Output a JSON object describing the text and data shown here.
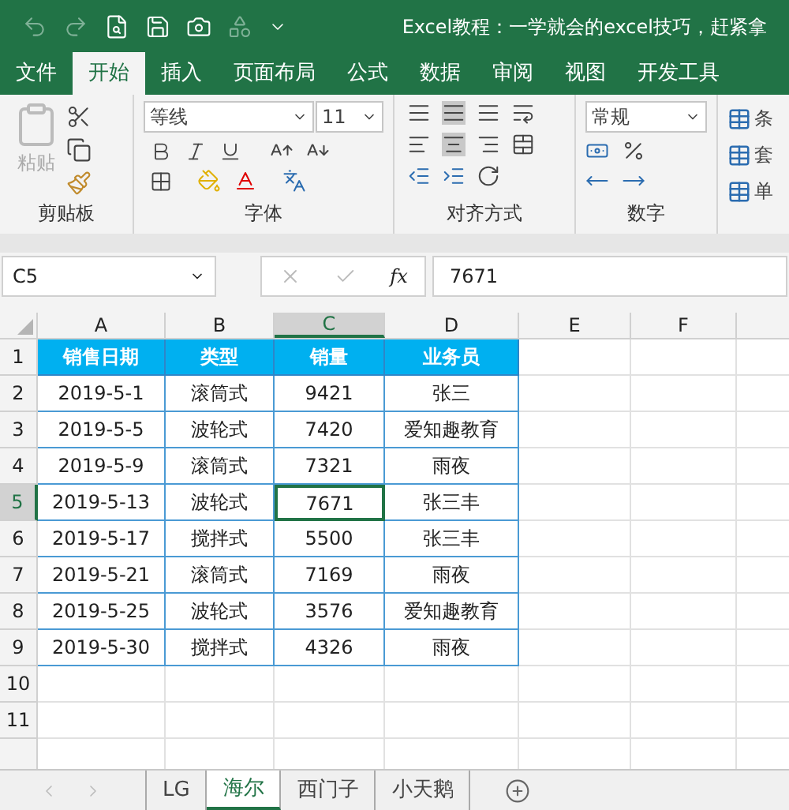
{
  "title_bar": {
    "title": "Excel教程：一学就会的excel技巧，赶紧拿"
  },
  "ribbon_tabs": [
    {
      "label": "文件",
      "selected": false
    },
    {
      "label": "开始",
      "selected": true
    },
    {
      "label": "插入",
      "selected": false
    },
    {
      "label": "页面布局",
      "selected": false
    },
    {
      "label": "公式",
      "selected": false
    },
    {
      "label": "数据",
      "selected": false
    },
    {
      "label": "审阅",
      "selected": false
    },
    {
      "label": "视图",
      "selected": false
    },
    {
      "label": "开发工具",
      "selected": false
    }
  ],
  "ribbon": {
    "clipboard": {
      "paste_label": "粘贴",
      "paste_disabled": true,
      "group_label": "剪贴板"
    },
    "font": {
      "font_name": "等线",
      "font_size": "11",
      "group_label": "字体"
    },
    "alignment": {
      "group_label": "对齐方式"
    },
    "number": {
      "format": "常规",
      "group_label": "数字"
    },
    "styles": {
      "items": [
        "条",
        "套",
        "单"
      ]
    }
  },
  "formula_bar": {
    "name_box": "C5",
    "function_button": "fx",
    "formula": "7671"
  },
  "columns": [
    {
      "label": "A",
      "selected": false
    },
    {
      "label": "B",
      "selected": false
    },
    {
      "label": "C",
      "selected": true
    },
    {
      "label": "D",
      "selected": false
    },
    {
      "label": "E",
      "selected": false
    },
    {
      "label": "F",
      "selected": false
    }
  ],
  "rows": [
    {
      "number": "1",
      "selected": false,
      "kind": "header",
      "cells": [
        {
          "text": "销售日期",
          "selected": false
        },
        {
          "text": "类型",
          "selected": false
        },
        {
          "text": "销量",
          "selected": false
        },
        {
          "text": "业务员",
          "selected": false
        }
      ]
    },
    {
      "number": "2",
      "selected": false,
      "kind": "data",
      "cells": [
        {
          "text": "2019-5-1",
          "selected": false
        },
        {
          "text": "滚筒式",
          "selected": false
        },
        {
          "text": "9421",
          "selected": false
        },
        {
          "text": "张三",
          "selected": false
        }
      ]
    },
    {
      "number": "3",
      "selected": false,
      "kind": "data",
      "cells": [
        {
          "text": "2019-5-5",
          "selected": false
        },
        {
          "text": "波轮式",
          "selected": false
        },
        {
          "text": "7420",
          "selected": false
        },
        {
          "text": "爱知趣教育",
          "selected": false
        }
      ]
    },
    {
      "number": "4",
      "selected": false,
      "kind": "data",
      "cells": [
        {
          "text": "2019-5-9",
          "selected": false
        },
        {
          "text": "滚筒式",
          "selected": false
        },
        {
          "text": "7321",
          "selected": false
        },
        {
          "text": "雨夜",
          "selected": false
        }
      ]
    },
    {
      "number": "5",
      "selected": true,
      "kind": "data",
      "cells": [
        {
          "text": "2019-5-13",
          "selected": false
        },
        {
          "text": "波轮式",
          "selected": false
        },
        {
          "text": "7671",
          "selected": true
        },
        {
          "text": "张三丰",
          "selected": false
        }
      ]
    },
    {
      "number": "6",
      "selected": false,
      "kind": "data",
      "cells": [
        {
          "text": "2019-5-17",
          "selected": false
        },
        {
          "text": "搅拌式",
          "selected": false
        },
        {
          "text": "5500",
          "selected": false
        },
        {
          "text": "张三丰",
          "selected": false
        }
      ]
    },
    {
      "number": "7",
      "selected": false,
      "kind": "data",
      "cells": [
        {
          "text": "2019-5-21",
          "selected": false
        },
        {
          "text": "滚筒式",
          "selected": false
        },
        {
          "text": "7169",
          "selected": false
        },
        {
          "text": "雨夜",
          "selected": false
        }
      ]
    },
    {
      "number": "8",
      "selected": false,
      "kind": "data",
      "cells": [
        {
          "text": "2019-5-25",
          "selected": false
        },
        {
          "text": "波轮式",
          "selected": false
        },
        {
          "text": "3576",
          "selected": false
        },
        {
          "text": "爱知趣教育",
          "selected": false
        }
      ]
    },
    {
      "number": "9",
      "selected": false,
      "kind": "data",
      "cells": [
        {
          "text": "2019-5-30",
          "selected": false
        },
        {
          "text": "搅拌式",
          "selected": false
        },
        {
          "text": "4326",
          "selected": false
        },
        {
          "text": "雨夜",
          "selected": false
        }
      ]
    },
    {
      "number": "10",
      "selected": false,
      "kind": "empty"
    },
    {
      "number": "11",
      "selected": false,
      "kind": "empty"
    }
  ],
  "sheet_tabs": [
    {
      "label": "LG",
      "selected": false
    },
    {
      "label": "海尔",
      "selected": true
    },
    {
      "label": "西门子",
      "selected": false
    },
    {
      "label": "小天鹅",
      "selected": false
    }
  ]
}
